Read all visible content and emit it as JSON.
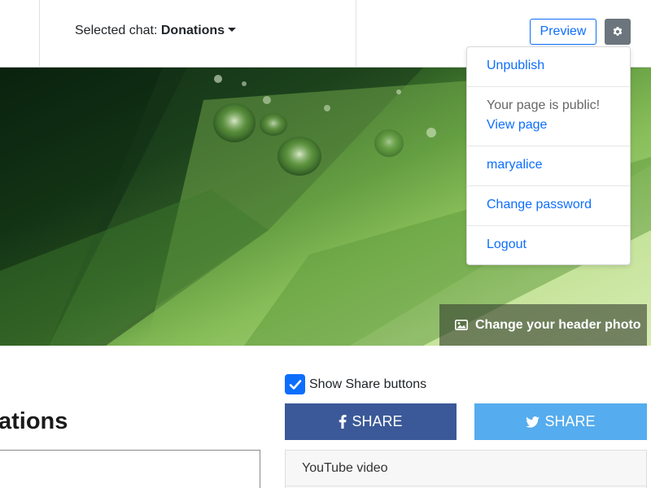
{
  "topbar": {
    "selected_chat_label": "Selected chat:",
    "selected_chat_value": "Donations",
    "preview_label": "Preview"
  },
  "dropdown": {
    "unpublish": "Unpublish",
    "public_status": "Your page is public!",
    "view_page": "View page",
    "username": "maryalice",
    "change_password": "Change password",
    "logout": "Logout"
  },
  "header": {
    "change_photo_label": "Change your header photo"
  },
  "main": {
    "title_fragment": "ations",
    "show_share_label": "Show Share buttons",
    "show_share_checked": true,
    "facebook_share_label": "SHARE",
    "twitter_share_label": "SHARE",
    "youtube_label": "YouTube video"
  },
  "colors": {
    "accent": "#0d6efd",
    "facebook": "#3b5998",
    "twitter": "#55acee",
    "gear_bg": "#6c757d"
  }
}
